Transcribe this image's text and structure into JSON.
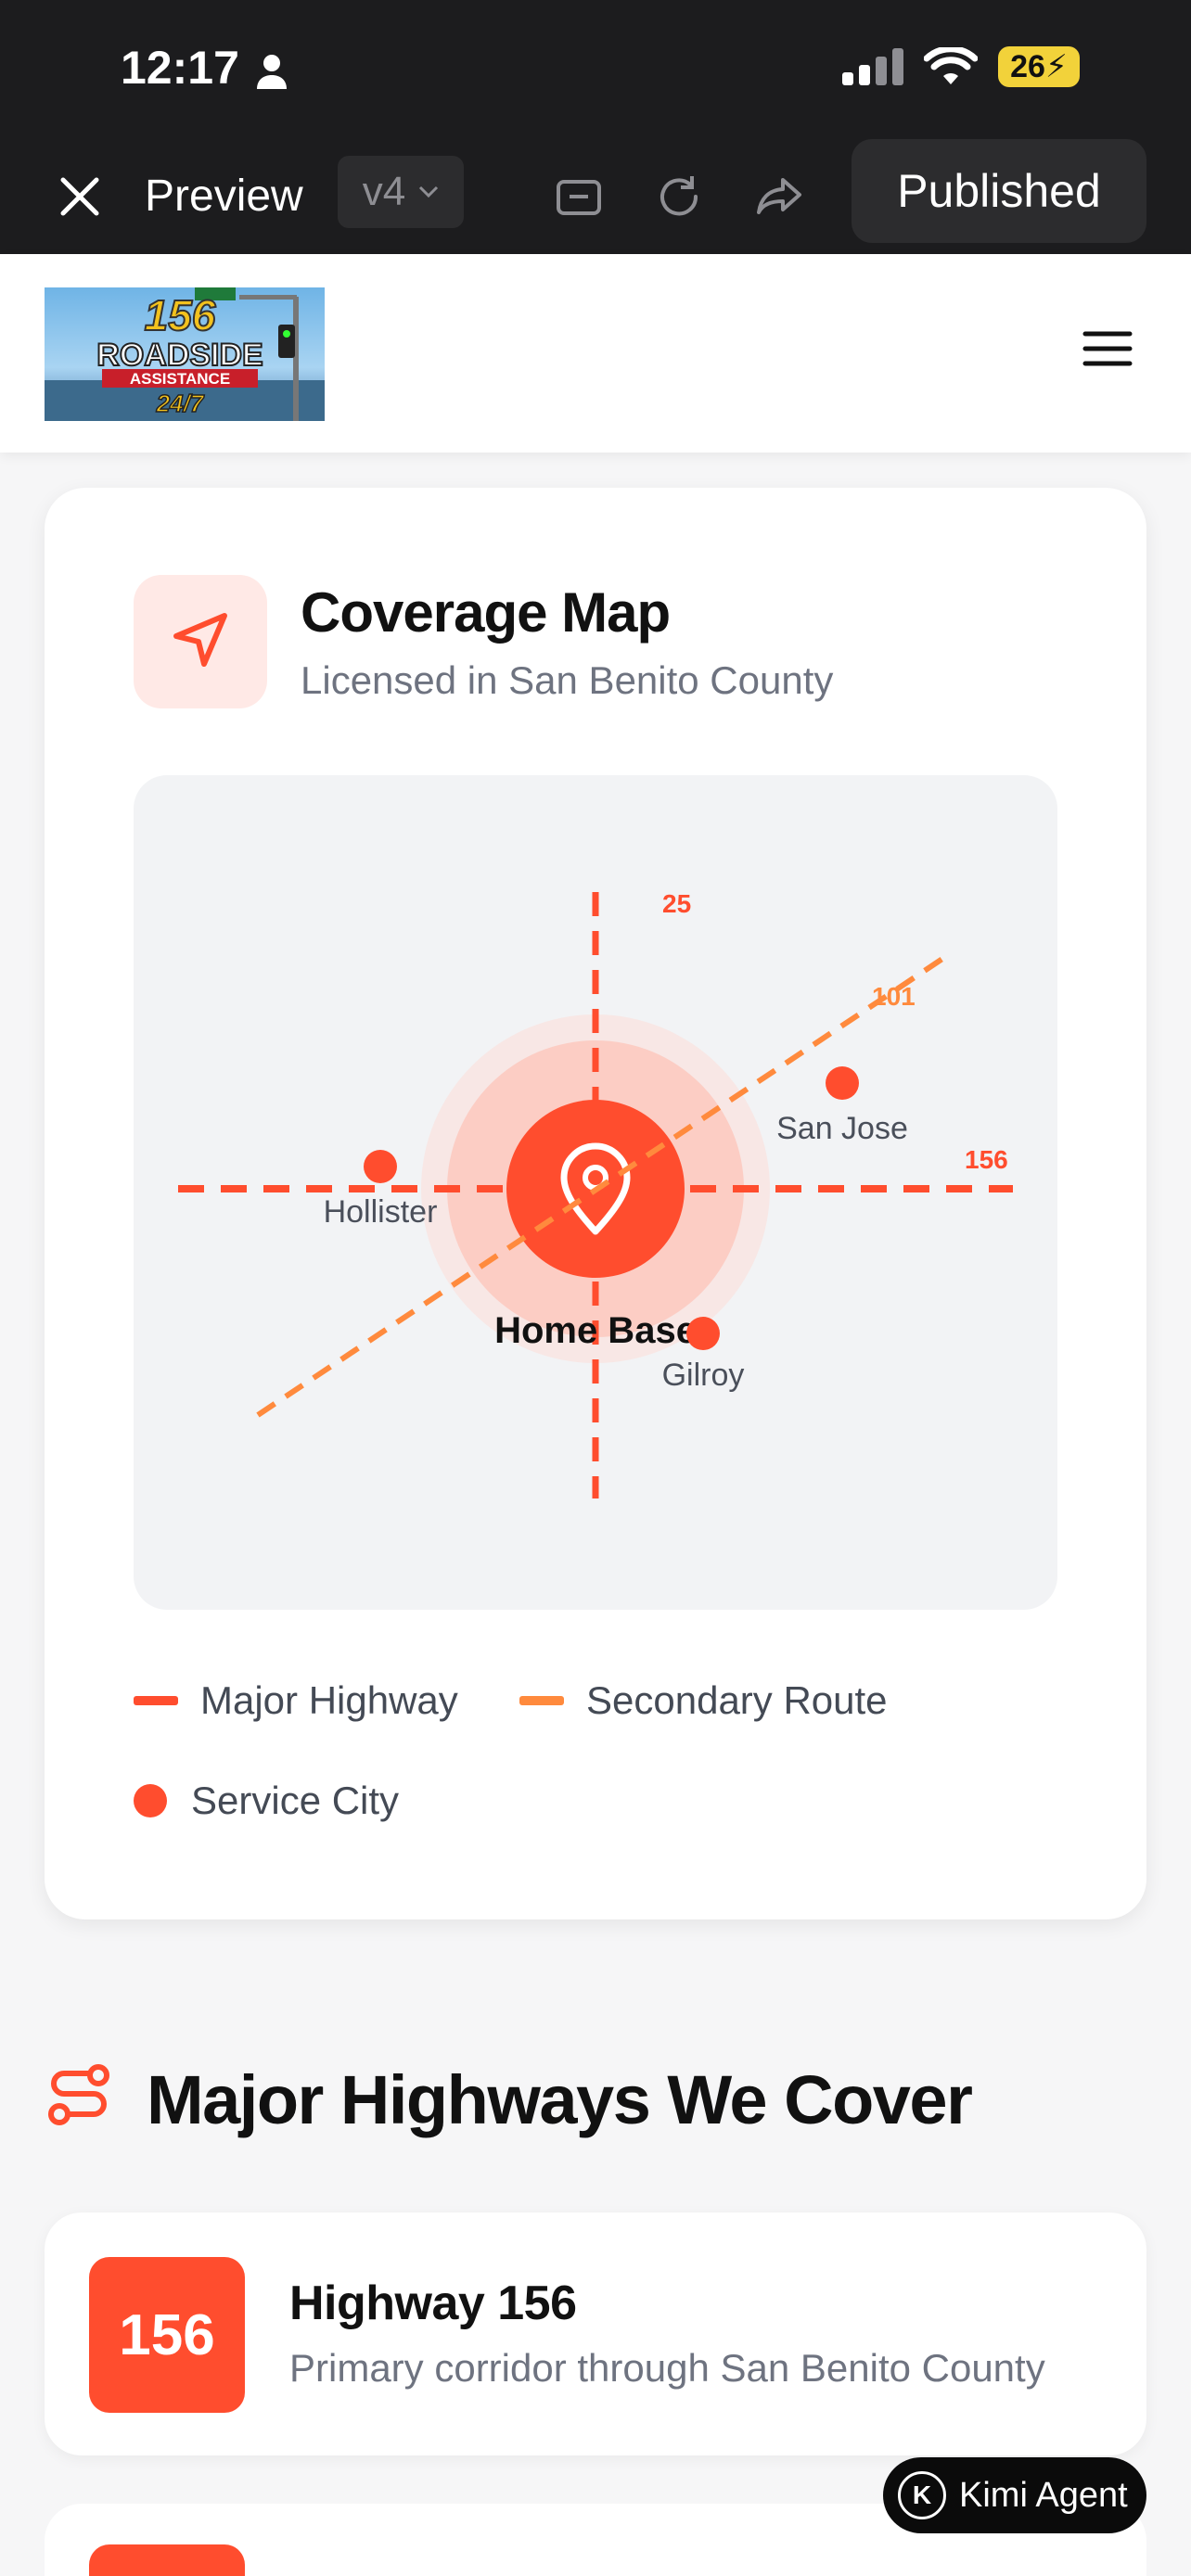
{
  "status_bar": {
    "time": "12:17",
    "battery": "26"
  },
  "toolbar": {
    "preview_label": "Preview",
    "version": "v4",
    "published_label": "Published"
  },
  "header": {
    "logo_line1": "156",
    "logo_line2": "ROADSIDE",
    "logo_line3": "ASSISTANCE",
    "logo_line4": "24/7"
  },
  "coverage": {
    "title": "Coverage Map",
    "subtitle": "Licensed in San Benito County",
    "map": {
      "route_labels": {
        "hwy25": "25",
        "hwy101": "101",
        "hwy156": "156"
      },
      "cities": [
        "Hollister",
        "San Jose",
        "Gilroy"
      ],
      "home_label": "Home Base"
    },
    "legend": {
      "major": "Major Highway",
      "secondary": "Secondary Route",
      "city": "Service City"
    },
    "colors": {
      "accent": "#ff4d2e",
      "secondary": "#ff8a3d"
    }
  },
  "highways": {
    "section_title": "Major Highways We Cover",
    "items": [
      {
        "badge": "156",
        "name": "Highway 156",
        "desc": "Primary corridor through San Benito County"
      }
    ]
  },
  "kimi": {
    "label": "Kimi Agent",
    "initial": "K"
  }
}
